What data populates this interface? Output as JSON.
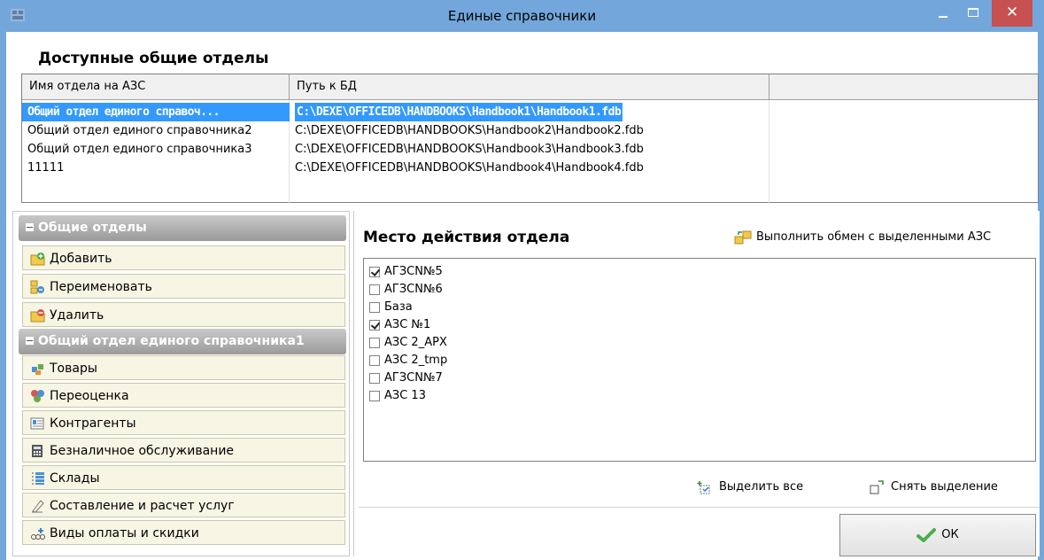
{
  "window": {
    "title": "Единые справочники"
  },
  "departments": {
    "section_title": "Доступные общие отделы",
    "columns": [
      "Имя отдела на АЗС",
      "Путь к БД"
    ],
    "rows": [
      {
        "name": "Общий отдел единого справоч...",
        "path": "C:\\DEXE\\OFFICEDB\\HANDBOOKS\\Handbook1\\Handbook1.fdb",
        "selected": true
      },
      {
        "name": "Общий отдел единого справочника2",
        "path": "C:\\DEXE\\OFFICEDB\\HANDBOOKS\\Handbook2\\Handbook2.fdb",
        "selected": false
      },
      {
        "name": "Общий отдел единого справочника3",
        "path": "C:\\DEXE\\OFFICEDB\\HANDBOOKS\\Handbook3\\Handbook3.fdb",
        "selected": false
      },
      {
        "name": "11111",
        "path": "C:\\DEXE\\OFFICEDB\\HANDBOOKS\\Handbook4\\Handbook4.fdb",
        "selected": false
      }
    ]
  },
  "sidebar": {
    "group1": {
      "title": "Общие отделы",
      "items": [
        {
          "label": "Добавить",
          "icon": "add-folder-icon"
        },
        {
          "label": "Переименовать",
          "icon": "rename-icon"
        },
        {
          "label": "Удалить",
          "icon": "delete-folder-icon"
        }
      ]
    },
    "group2": {
      "title": "Общий отдел единого справочника1",
      "items": [
        {
          "label": "Товары",
          "icon": "goods-icon"
        },
        {
          "label": "Переоценка",
          "icon": "revaluation-icon"
        },
        {
          "label": "Контрагенты",
          "icon": "contractors-icon"
        },
        {
          "label": "Безналичное обслуживание",
          "icon": "calculator-icon"
        },
        {
          "label": "Склады",
          "icon": "warehouse-icon"
        },
        {
          "label": "Составление и расчет услуг",
          "icon": "services-icon"
        },
        {
          "label": "Виды оплаты и скидки",
          "icon": "payment-icon"
        }
      ]
    }
  },
  "location": {
    "title": "Место действия отдела",
    "exchange_label": "Выполнить обмен с выделенными АЗС",
    "stations": [
      {
        "label": "АГЗСN№5",
        "checked": true
      },
      {
        "label": "АГЗСN№6",
        "checked": false
      },
      {
        "label": "База",
        "checked": false
      },
      {
        "label": "АЗС №1",
        "checked": true
      },
      {
        "label": "АЗС 2_АРХ",
        "checked": false
      },
      {
        "label": "АЗС 2_tmp",
        "checked": false
      },
      {
        "label": "АГЗСN№7",
        "checked": false
      },
      {
        "label": "АЗС 13",
        "checked": false
      }
    ],
    "select_all_label": "Выделить все",
    "deselect_all_label": "Снять выделение"
  },
  "ok_label": "ОК",
  "colors": {
    "titlebar": "#73a7db",
    "selection": "#3399ff",
    "close": "#c75050",
    "nav_item_bg": "#f7f5e4"
  }
}
